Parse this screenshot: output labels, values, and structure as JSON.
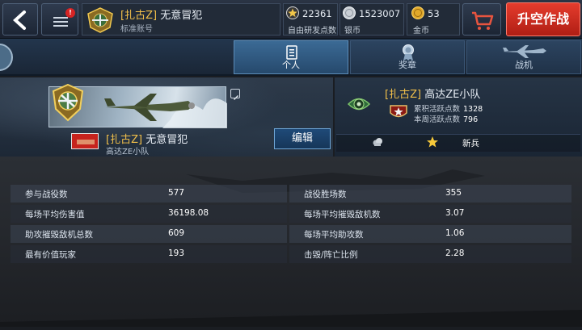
{
  "header": {
    "player_tag": "[扎古Z]",
    "player_name": "无意冒犯",
    "account_type": "标准账号",
    "badge_count": "!",
    "research_points": {
      "value": "22361",
      "label": "自由研发点数"
    },
    "silver": {
      "value": "1523007",
      "label": "银币"
    },
    "gold": {
      "value": "53",
      "label": "金币"
    },
    "sortie_label": "升空作战"
  },
  "tabs": [
    {
      "label": "个人",
      "active": true
    },
    {
      "label": "奖章",
      "active": false
    },
    {
      "label": "战机",
      "active": false
    }
  ],
  "profile": {
    "tag": "[扎古Z]",
    "name": "无意冒犯",
    "squad": "高达ZE小队",
    "edit_label": "编辑"
  },
  "clan": {
    "tag": "[扎古Z]",
    "name": "高达ZE小队",
    "total_activity_label": "累积活跃点数",
    "total_activity_value": "1328",
    "weekly_activity_label": "本周活跃点数",
    "weekly_activity_value": "796",
    "rank_label": "新兵"
  },
  "stats": {
    "left": [
      {
        "label": "参与战役数",
        "value": "577"
      },
      {
        "label": "每场平均伤害值",
        "value": "36198.08"
      },
      {
        "label": "助攻摧毁敌机总数",
        "value": "609"
      },
      {
        "label": "最有价值玩家",
        "value": "193"
      }
    ],
    "right": [
      {
        "label": "战役胜场数",
        "value": "355"
      },
      {
        "label": "每场平均摧毁敌机数",
        "value": "3.07"
      },
      {
        "label": "每场平均助攻数",
        "value": "1.06"
      },
      {
        "label": "击毁/阵亡比例",
        "value": "2.28"
      }
    ]
  },
  "icons": {
    "back": "back-arrow-icon",
    "menu": "menu-icon",
    "research": "star-medal-icon",
    "silver": "silver-coin-icon",
    "gold": "gold-coin-icon",
    "cart": "cart-icon",
    "personal": "document-icon",
    "medals": "medal-icon",
    "planes": "plane-icon"
  },
  "colors": {
    "accent_red": "#d8352a",
    "tag_gold": "#f2c04a",
    "tab_active": "#3b6a95"
  }
}
